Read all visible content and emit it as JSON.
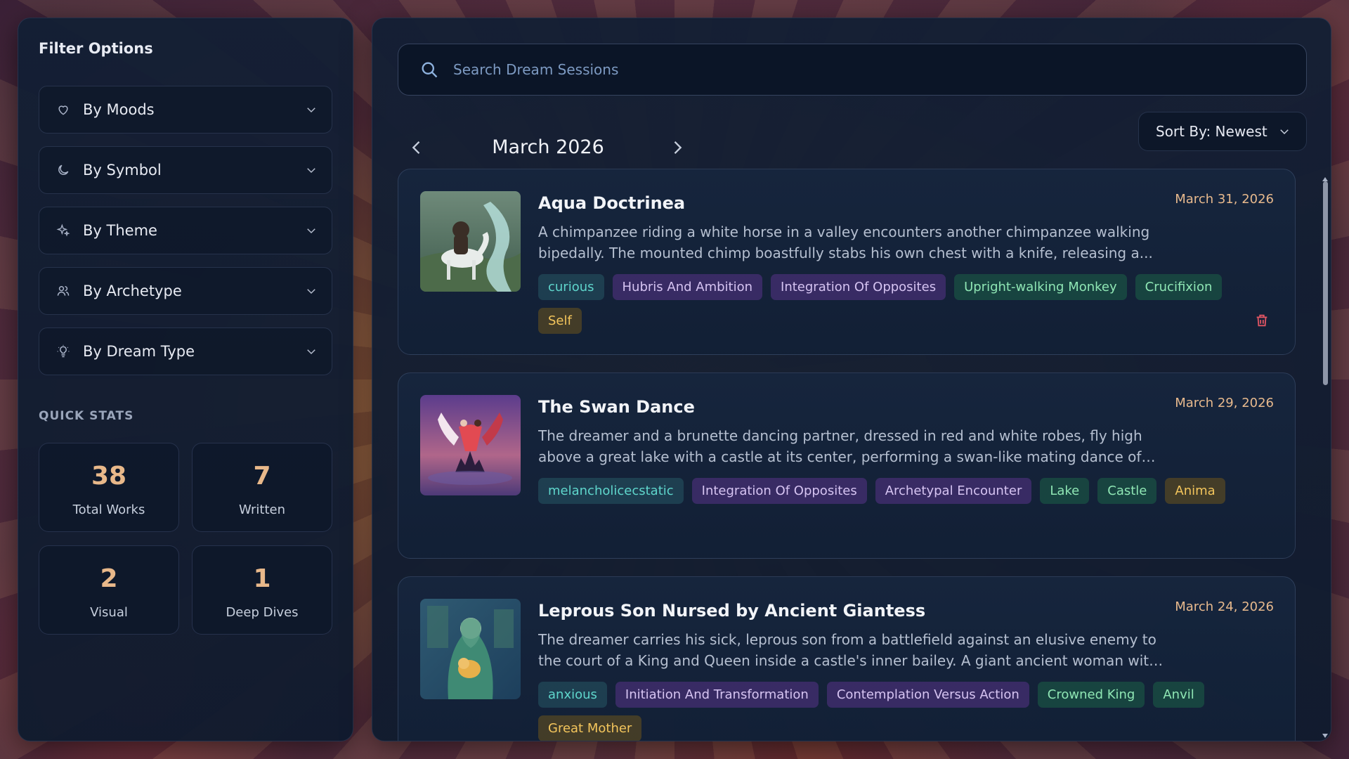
{
  "sidebar": {
    "title": "Filter Options",
    "filters": [
      {
        "label": "By Moods",
        "icon": "heart-icon"
      },
      {
        "label": "By Symbol",
        "icon": "moon-icon"
      },
      {
        "label": "By Theme",
        "icon": "sparkles-icon"
      },
      {
        "label": "By Archetype",
        "icon": "users-icon"
      },
      {
        "label": "By Dream Type",
        "icon": "lightbulb-icon"
      }
    ],
    "quick_stats_label": "QUICK STATS",
    "stats": [
      {
        "value": "38",
        "label": "Total Works"
      },
      {
        "value": "7",
        "label": "Written"
      },
      {
        "value": "2",
        "label": "Visual"
      },
      {
        "value": "1",
        "label": "Deep Dives"
      }
    ]
  },
  "main": {
    "search_placeholder": "Search Dream Sessions",
    "month": "March 2026",
    "sort_label": "Sort By: Newest",
    "cards": [
      {
        "title": "Aqua Doctrinea",
        "date": "March 31, 2026",
        "description": "A chimpanzee riding a white horse in a valley encounters another chimpanzee walking bipedally. The mounted chimp boastfully stabs his own chest with a knife, releasing a...",
        "tags": [
          {
            "text": "curious",
            "kind": "mood"
          },
          {
            "text": "Hubris And Ambition",
            "kind": "theme"
          },
          {
            "text": "Integration Of Opposites",
            "kind": "theme"
          },
          {
            "text": "Upright-walking Monkey",
            "kind": "symbol"
          },
          {
            "text": "Crucifixion",
            "kind": "symbol"
          },
          {
            "text": "Self",
            "kind": "arch"
          }
        ]
      },
      {
        "title": "The Swan Dance",
        "date": "March 29, 2026",
        "description": "The dreamer and a brunette dancing partner, dressed in red and white robes, fly high above a great lake with a castle at its center, performing a swan-like mating dance of extraordinar...",
        "tags": [
          {
            "text": "melancholicecstatic",
            "kind": "mood"
          },
          {
            "text": "Integration Of Opposites",
            "kind": "theme"
          },
          {
            "text": "Archetypal Encounter",
            "kind": "theme"
          },
          {
            "text": "Lake",
            "kind": "symbol"
          },
          {
            "text": "Castle",
            "kind": "symbol"
          },
          {
            "text": "Anima",
            "kind": "arch"
          }
        ]
      },
      {
        "title": "Leprous Son Nursed by Ancient Giantess",
        "date": "March 24, 2026",
        "description": "The dreamer carries his sick, leprous son from a battlefield against an elusive enemy to the court of a King and Queen inside a castle's inner bailey. A giant ancient woman with grey...",
        "tags": [
          {
            "text": "anxious",
            "kind": "mood"
          },
          {
            "text": "Initiation And Transformation",
            "kind": "theme"
          },
          {
            "text": "Contemplation Versus Action",
            "kind": "theme"
          },
          {
            "text": "Crowned King",
            "kind": "symbol"
          },
          {
            "text": "Anvil",
            "kind": "symbol"
          },
          {
            "text": "Great Mother",
            "kind": "arch"
          }
        ]
      }
    ]
  },
  "colors": {
    "accent_date": "#e7b98d",
    "mood_tag": "#5fd6cc",
    "theme_tag": "#d6c4f2",
    "symbol_tag": "#8fe6b4",
    "archetype_tag": "#f3c55c",
    "delete": "#e05563"
  }
}
